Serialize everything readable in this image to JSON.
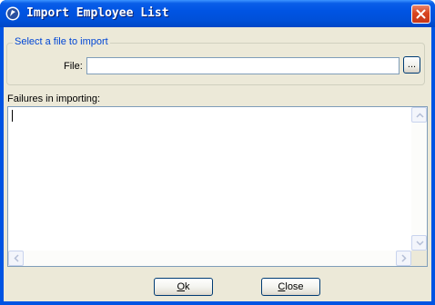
{
  "window": {
    "title": "Import Employee List"
  },
  "file_group": {
    "legend": "Select a file to import",
    "file_label": "File:",
    "file_value": "",
    "browse_label": "..."
  },
  "failures": {
    "label": "Failures in importing:",
    "content": ""
  },
  "buttons": {
    "ok_label": "Ok",
    "ok_mnemonic": "O",
    "ok_rest": "k",
    "close_label": "Close",
    "close_mnemonic": "C",
    "close_rest": "lose"
  },
  "icons": {
    "app": "app-logo-icon",
    "close": "close-icon",
    "scroll_up": "chevron-up-icon",
    "scroll_down": "chevron-down-icon",
    "scroll_left": "chevron-left-icon",
    "scroll_right": "chevron-right-icon"
  },
  "colors": {
    "titlebar": "#0054e3",
    "client": "#ece9d8",
    "legend_text": "#0046d5",
    "close_button": "#d9441f"
  }
}
